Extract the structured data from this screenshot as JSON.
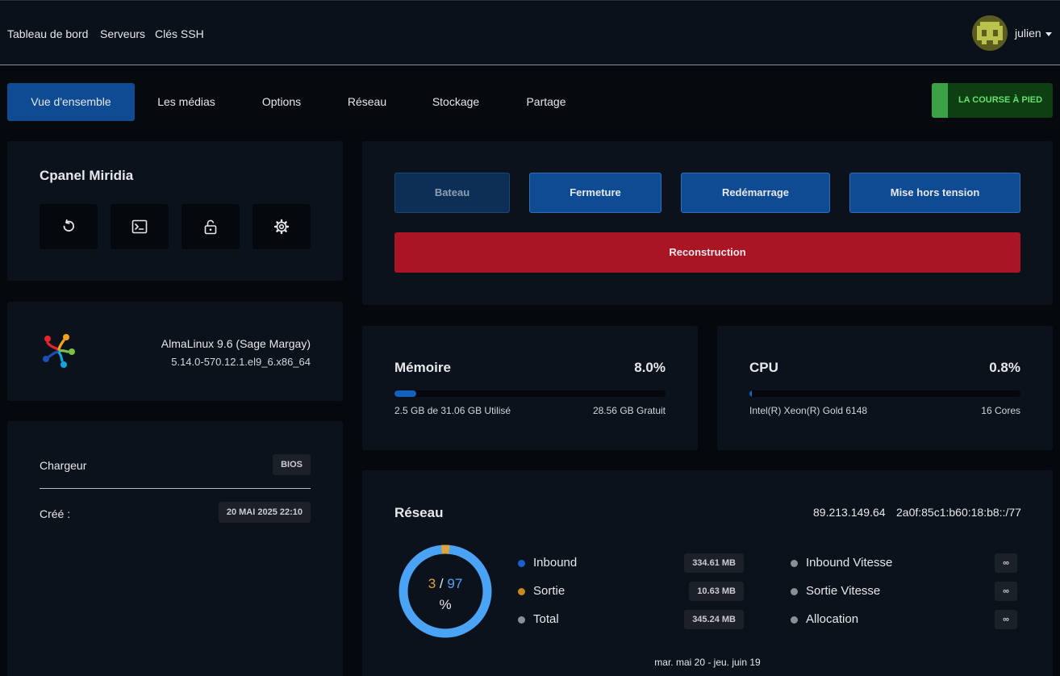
{
  "nav": {
    "links": [
      "Tableau de bord",
      "Serveurs",
      "Clés SSH"
    ],
    "user": "julien"
  },
  "tabs": [
    "Vue d'ensemble",
    "Les médias",
    "Options",
    "Réseau",
    "Stockage",
    "Partage"
  ],
  "status": "LA COURSE À PIED",
  "server": {
    "name": "Cpanel Miridia",
    "quick_actions": [
      "restart-icon",
      "terminal-icon",
      "lock-icon",
      "gear-icon"
    ]
  },
  "os": {
    "name": "AlmaLinux 9.6 (Sage Margay)",
    "kernel": "5.14.0-570.12.1.el9_6.x86_64"
  },
  "info": {
    "loader_label": "Chargeur",
    "loader_value": "BIOS",
    "created_label": "Créé :",
    "created_value": "20 MAI 2025 22:10"
  },
  "power": {
    "buttons": [
      "Bateau",
      "Fermeture",
      "Redémarrage",
      "Mise hors tension"
    ],
    "rebuild": "Reconstruction"
  },
  "memory": {
    "title": "Mémoire",
    "percent": "8.0%",
    "fraction": 0.08,
    "used": "2.5 GB de 31.06 GB Utilisé",
    "free": "28.56 GB Gratuit"
  },
  "cpu": {
    "title": "CPU",
    "percent": "0.8%",
    "fraction": 0.008,
    "model": "Intel(R) Xeon(R) Gold 6148",
    "cores": "16 Cores"
  },
  "network": {
    "title": "Réseau",
    "ipv4": "89.213.149.64",
    "ipv6": "2a0f:85c1:b60:18:b8::/77",
    "split_out": "3",
    "split_sep": "/",
    "split_in": "97",
    "split_unit": "%",
    "out_fraction": 0.03,
    "rows": [
      {
        "label": "Inbound",
        "value": "334.61 MB",
        "color": "#1c5fcf"
      },
      {
        "label": "Sortie",
        "value": "10.63 MB",
        "color": "#c98a1c"
      },
      {
        "label": "Total",
        "value": "345.24 MB",
        "color": "#8a8f96"
      }
    ],
    "speed_rows": [
      {
        "label": "Inbound Vitesse",
        "value": "∞"
      },
      {
        "label": "Sortie Vitesse",
        "value": "∞"
      },
      {
        "label": "Allocation",
        "value": "∞"
      }
    ],
    "date_range": "mar. mai 20 - jeu. juin 19"
  },
  "colors": {
    "accent": "#0e4b93",
    "danger": "#a91523",
    "success": "#3aa245",
    "donut_in": "#4ba3f5",
    "donut_out": "#e0a43a"
  }
}
